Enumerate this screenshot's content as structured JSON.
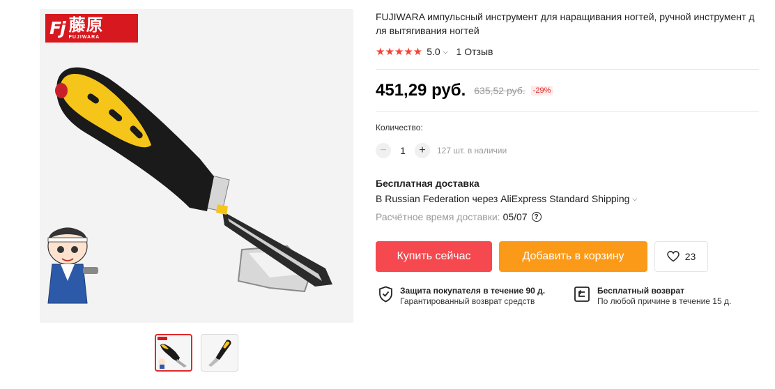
{
  "brand": {
    "logo_mark": "Fj",
    "logo_cn": "藤原",
    "logo_en": "FUJIWARA"
  },
  "product": {
    "title": "FUJIWARA импульсный инструмент для наращивания ногтей, ручной инструмент для вытягивания ногтей",
    "stars": "★★★★★",
    "rating": "5.0",
    "reviews": "1 Отзыв"
  },
  "price": {
    "current": "451,29 руб.",
    "old": "635,52 руб.",
    "discount": "-29%"
  },
  "quantity": {
    "label": "Количество:",
    "value": "1",
    "minus": "−",
    "plus": "+",
    "stock": "127 шт. в наличии"
  },
  "shipping": {
    "title": "Бесплатная доставка",
    "route": "В Russian Federation через AliExpress Standard Shipping",
    "eta_label": "Расчётное время доставки:",
    "eta_value": "05/07",
    "help": "?"
  },
  "actions": {
    "buy": "Купить сейчас",
    "cart": "Добавить в корзину",
    "wishlist_count": "23"
  },
  "guarantees": {
    "buyer": {
      "title": "Защита покупателя в течение 90 д.",
      "subtitle": "Гарантированный возврат средств"
    },
    "returns": {
      "title": "Бесплатный возврат",
      "subtitle": "По любой причине в течение 15 д."
    }
  },
  "icons": {
    "chevron": "chevron-down-icon",
    "heart": "heart-icon",
    "shield": "shield-check-icon",
    "return": "return-arrow-icon",
    "help": "question-circle-icon"
  },
  "colors": {
    "buy": "#f5484f",
    "cart": "#fb9a18",
    "star": "#f44336",
    "discount": "#e02828",
    "logo": "#d7191f"
  }
}
